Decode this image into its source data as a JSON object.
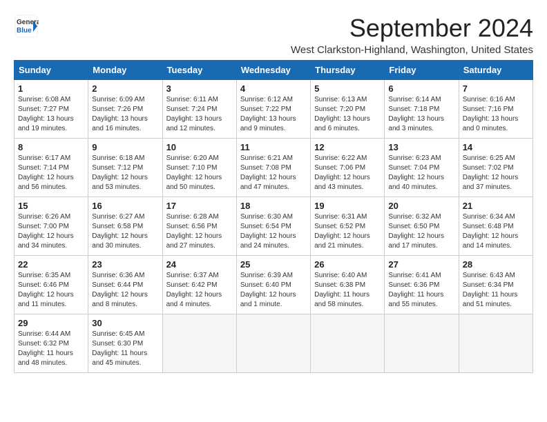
{
  "header": {
    "logo_general": "General",
    "logo_blue": "Blue",
    "title": "September 2024",
    "subtitle": "West Clarkston-Highland, Washington, United States"
  },
  "weekdays": [
    "Sunday",
    "Monday",
    "Tuesday",
    "Wednesday",
    "Thursday",
    "Friday",
    "Saturday"
  ],
  "weeks": [
    [
      {
        "day": "1",
        "sunrise": "6:08 AM",
        "sunset": "7:27 PM",
        "daylight": "13 hours and 19 minutes."
      },
      {
        "day": "2",
        "sunrise": "6:09 AM",
        "sunset": "7:26 PM",
        "daylight": "13 hours and 16 minutes."
      },
      {
        "day": "3",
        "sunrise": "6:11 AM",
        "sunset": "7:24 PM",
        "daylight": "13 hours and 12 minutes."
      },
      {
        "day": "4",
        "sunrise": "6:12 AM",
        "sunset": "7:22 PM",
        "daylight": "13 hours and 9 minutes."
      },
      {
        "day": "5",
        "sunrise": "6:13 AM",
        "sunset": "7:20 PM",
        "daylight": "13 hours and 6 minutes."
      },
      {
        "day": "6",
        "sunrise": "6:14 AM",
        "sunset": "7:18 PM",
        "daylight": "13 hours and 3 minutes."
      },
      {
        "day": "7",
        "sunrise": "6:16 AM",
        "sunset": "7:16 PM",
        "daylight": "13 hours and 0 minutes."
      }
    ],
    [
      {
        "day": "8",
        "sunrise": "6:17 AM",
        "sunset": "7:14 PM",
        "daylight": "12 hours and 56 minutes."
      },
      {
        "day": "9",
        "sunrise": "6:18 AM",
        "sunset": "7:12 PM",
        "daylight": "12 hours and 53 minutes."
      },
      {
        "day": "10",
        "sunrise": "6:20 AM",
        "sunset": "7:10 PM",
        "daylight": "12 hours and 50 minutes."
      },
      {
        "day": "11",
        "sunrise": "6:21 AM",
        "sunset": "7:08 PM",
        "daylight": "12 hours and 47 minutes."
      },
      {
        "day": "12",
        "sunrise": "6:22 AM",
        "sunset": "7:06 PM",
        "daylight": "12 hours and 43 minutes."
      },
      {
        "day": "13",
        "sunrise": "6:23 AM",
        "sunset": "7:04 PM",
        "daylight": "12 hours and 40 minutes."
      },
      {
        "day": "14",
        "sunrise": "6:25 AM",
        "sunset": "7:02 PM",
        "daylight": "12 hours and 37 minutes."
      }
    ],
    [
      {
        "day": "15",
        "sunrise": "6:26 AM",
        "sunset": "7:00 PM",
        "daylight": "12 hours and 34 minutes."
      },
      {
        "day": "16",
        "sunrise": "6:27 AM",
        "sunset": "6:58 PM",
        "daylight": "12 hours and 30 minutes."
      },
      {
        "day": "17",
        "sunrise": "6:28 AM",
        "sunset": "6:56 PM",
        "daylight": "12 hours and 27 minutes."
      },
      {
        "day": "18",
        "sunrise": "6:30 AM",
        "sunset": "6:54 PM",
        "daylight": "12 hours and 24 minutes."
      },
      {
        "day": "19",
        "sunrise": "6:31 AM",
        "sunset": "6:52 PM",
        "daylight": "12 hours and 21 minutes."
      },
      {
        "day": "20",
        "sunrise": "6:32 AM",
        "sunset": "6:50 PM",
        "daylight": "12 hours and 17 minutes."
      },
      {
        "day": "21",
        "sunrise": "6:34 AM",
        "sunset": "6:48 PM",
        "daylight": "12 hours and 14 minutes."
      }
    ],
    [
      {
        "day": "22",
        "sunrise": "6:35 AM",
        "sunset": "6:46 PM",
        "daylight": "12 hours and 11 minutes."
      },
      {
        "day": "23",
        "sunrise": "6:36 AM",
        "sunset": "6:44 PM",
        "daylight": "12 hours and 8 minutes."
      },
      {
        "day": "24",
        "sunrise": "6:37 AM",
        "sunset": "6:42 PM",
        "daylight": "12 hours and 4 minutes."
      },
      {
        "day": "25",
        "sunrise": "6:39 AM",
        "sunset": "6:40 PM",
        "daylight": "12 hours and 1 minute."
      },
      {
        "day": "26",
        "sunrise": "6:40 AM",
        "sunset": "6:38 PM",
        "daylight": "11 hours and 58 minutes."
      },
      {
        "day": "27",
        "sunrise": "6:41 AM",
        "sunset": "6:36 PM",
        "daylight": "11 hours and 55 minutes."
      },
      {
        "day": "28",
        "sunrise": "6:43 AM",
        "sunset": "6:34 PM",
        "daylight": "11 hours and 51 minutes."
      }
    ],
    [
      {
        "day": "29",
        "sunrise": "6:44 AM",
        "sunset": "6:32 PM",
        "daylight": "11 hours and 48 minutes."
      },
      {
        "day": "30",
        "sunrise": "6:45 AM",
        "sunset": "6:30 PM",
        "daylight": "11 hours and 45 minutes."
      },
      null,
      null,
      null,
      null,
      null
    ]
  ]
}
